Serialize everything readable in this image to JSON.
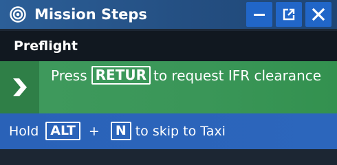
{
  "window": {
    "title": "Mission Steps",
    "icon": "target-icon",
    "controls": {
      "minimize_icon": "minimize-icon",
      "popout_icon": "popout-icon",
      "close_icon": "close-icon"
    }
  },
  "section": {
    "label": "Preflight"
  },
  "current_step": {
    "indicator_icon": "chevron-right-icon",
    "text_before": "Press",
    "key": "RETUR",
    "text_after": "to request IFR clearance"
  },
  "next_step": {
    "text_before": "Hold",
    "key1": "ALT",
    "plus": "+",
    "key2": "N",
    "text_after": "to skip to Taxi"
  },
  "colors": {
    "titlebar": "#2c5f98",
    "window_button": "#2166c8",
    "section_bg": "#111820",
    "active_step": "#3f9a5d",
    "next_step": "#2a62b8"
  }
}
